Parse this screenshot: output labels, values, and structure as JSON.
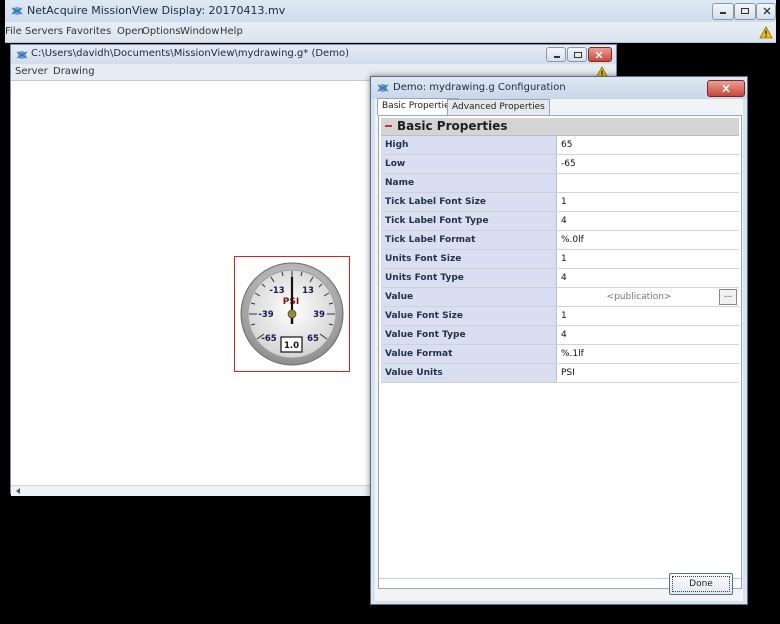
{
  "main_window": {
    "title": "NetAcquire MissionView Display: 20170413.mv",
    "menu": [
      "File",
      "Servers",
      "Favorites",
      "Open",
      "Options",
      "Window",
      "Help"
    ]
  },
  "child_window": {
    "title": "C:\\Users\\davidh\\Documents\\MissionView\\mydrawing.g* (Demo)",
    "menu": [
      "Server",
      "Drawing"
    ]
  },
  "gauge": {
    "tick_labels": [
      "-13",
      "13",
      "-39",
      "39",
      "-65",
      "65"
    ],
    "units": "PSI",
    "value": "1.0"
  },
  "dialog": {
    "title": "Demo: mydrawing.g Configuration",
    "tabs": [
      "Basic Properties",
      "Advanced Properties"
    ],
    "section": "Basic Properties",
    "rows": [
      {
        "name": "High",
        "value": "65"
      },
      {
        "name": "Low",
        "value": "-65"
      },
      {
        "name": "Name",
        "value": ""
      },
      {
        "name": "Tick Label Font Size",
        "value": "1"
      },
      {
        "name": "Tick Label Font Type",
        "value": "4"
      },
      {
        "name": "Tick Label Format",
        "value": "%.0lf"
      },
      {
        "name": "Units Font Size",
        "value": "1"
      },
      {
        "name": "Units Font Type",
        "value": "4"
      },
      {
        "name": "Value",
        "value": "<publication>"
      },
      {
        "name": "Value Font Size",
        "value": "1"
      },
      {
        "name": "Value Font Type",
        "value": "4"
      },
      {
        "name": "Value Format",
        "value": "%.1lf"
      },
      {
        "name": "Value Units",
        "value": "PSI"
      }
    ],
    "ellipsis_label": "...",
    "done_label": "Done"
  },
  "colors": {
    "selection_frame": "#e02020",
    "property_name_bg": "#d9dff1",
    "warning": "#f5c400"
  }
}
